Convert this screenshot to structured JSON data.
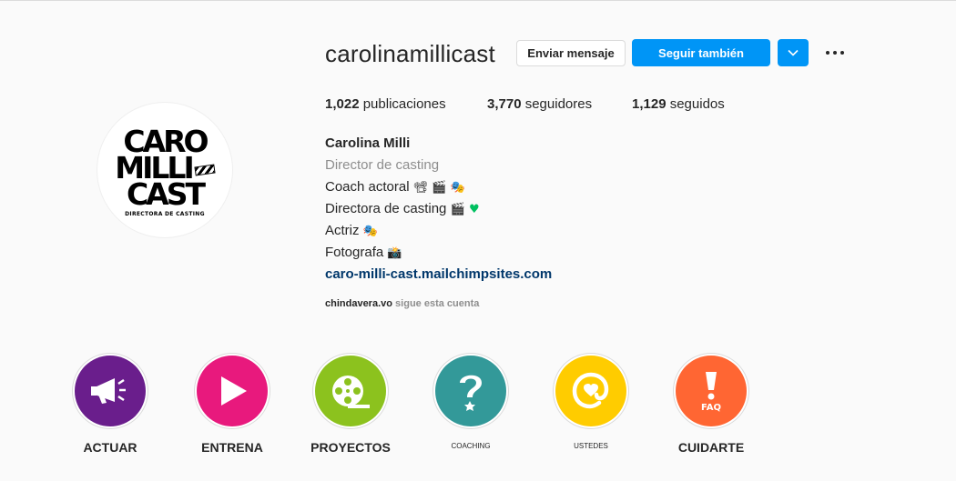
{
  "profile": {
    "username": "carolinamillicast",
    "buttons": {
      "message": "Enviar mensaje",
      "follow": "Seguir también"
    },
    "stats": {
      "posts_count": "1,022",
      "posts_label": "publicaciones",
      "followers_count": "3,770",
      "followers_label": "seguidores",
      "following_count": "1,129",
      "following_label": "seguidos"
    },
    "avatar_logo": {
      "line1": "CARO",
      "line2": "MILLI",
      "line3": "CAST",
      "sub": "DIRECTORA DE CASTING"
    },
    "bio": {
      "name": "Carolina Milli",
      "category": "Director de casting",
      "line1": "Coach actoral",
      "line1_emojis": "📽 🎬 🎭",
      "line2": "Directora de casting",
      "line2_emojis": "🎬",
      "line2_heart": "♥",
      "line3": "Actriz",
      "line3_emojis": "🎭",
      "line4": "Fotografa",
      "line4_emojis": "📸",
      "link": "caro-milli-cast.mailchimpsites.com"
    },
    "followed_by": {
      "user": "chindavera.vo",
      "text": "sigue esta cuenta"
    }
  },
  "highlights": [
    {
      "label": "ACTUAR",
      "color": "#6a1e8c",
      "icon": "megaphone-icon"
    },
    {
      "label": "ENTRENA",
      "color": "#e8197d",
      "icon": "play-icon"
    },
    {
      "label": "PROYECTOS",
      "color": "#8cc21e",
      "icon": "film-reel-icon"
    },
    {
      "label": "COACHING",
      "color": "#339999",
      "icon": "question-icon"
    },
    {
      "label": "USTEDES",
      "color": "#ffcc00",
      "icon": "at-heart-icon"
    },
    {
      "label": "CUIDARTE",
      "color": "#ff6633",
      "icon": "exclamation-faq-icon"
    }
  ],
  "colors": {
    "accent": "#0095f6",
    "link": "#00376b",
    "muted": "#8e8e8e",
    "background": "#fafafa"
  }
}
